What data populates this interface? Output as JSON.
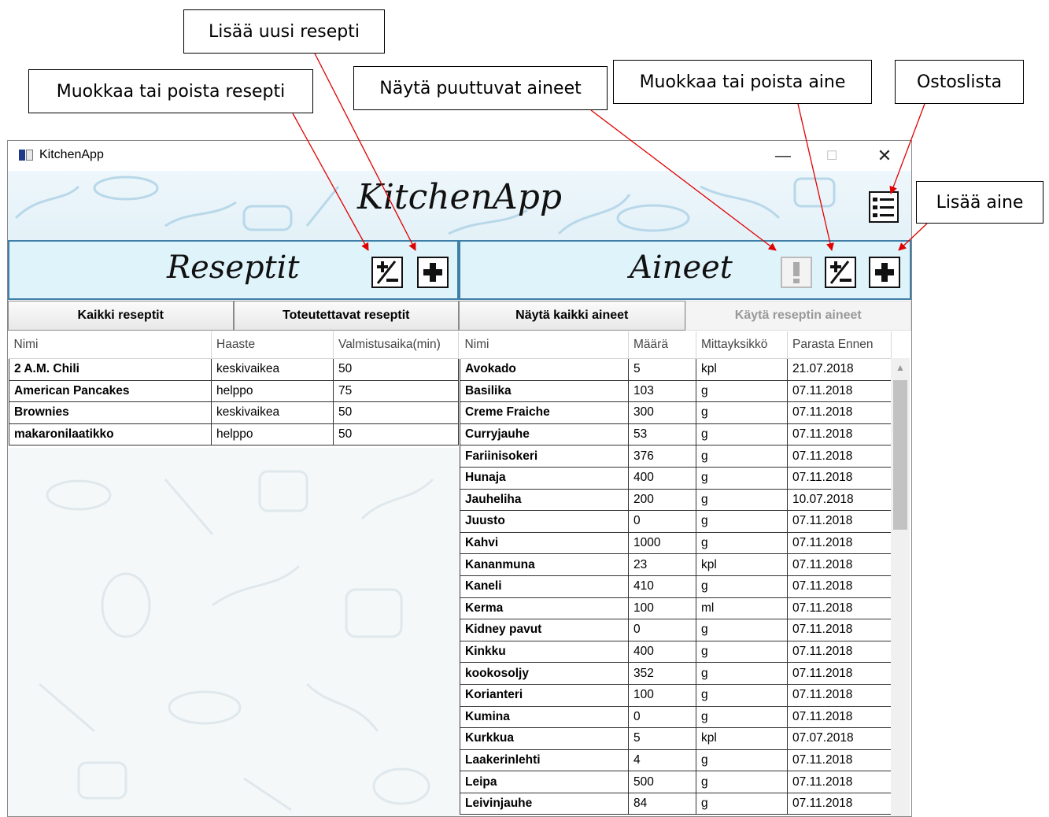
{
  "callouts": {
    "edit_recipe": "Muokkaa tai poista resepti",
    "add_recipe": "Lisää uusi resepti",
    "missing": "Näytä puuttuvat aineet",
    "edit_ingredient": "Muokkaa tai poista aine",
    "shopping_list": "Ostoslista",
    "add_ingredient": "Lisää aine"
  },
  "window": {
    "title": "KitchenApp",
    "app_title": "KitchenApp",
    "minimize": "—",
    "maximize": "☐",
    "close": "✕"
  },
  "recipes": {
    "title": "Reseptit",
    "tabs": [
      "Kaikki reseptit",
      "Toteutettavat reseptit"
    ],
    "columns": [
      "Nimi",
      "Haaste",
      "Valmistusaika(min)"
    ],
    "rows": [
      [
        "2 A.M. Chili",
        "keskivaikea",
        "50"
      ],
      [
        "American Pancakes",
        "helppo",
        "75"
      ],
      [
        "Brownies",
        "keskivaikea",
        "50"
      ],
      [
        "makaronilaatikko",
        "helppo",
        "50"
      ]
    ]
  },
  "ingredients": {
    "title": "Aineet",
    "tabs": [
      "Näytä kaikki aineet",
      "Käytä reseptin aineet"
    ],
    "columns": [
      "Nimi",
      "Määrä",
      "Mittayksikkö",
      "Parasta Ennen"
    ],
    "rows": [
      [
        "Avokado",
        "5",
        "kpl",
        "21.07.2018"
      ],
      [
        "Basilika",
        "103",
        "g",
        "07.11.2018"
      ],
      [
        "Creme Fraiche",
        "300",
        "g",
        "07.11.2018"
      ],
      [
        "Curryjauhe",
        "53",
        "g",
        "07.11.2018"
      ],
      [
        "Fariinisokeri",
        "376",
        "g",
        "07.11.2018"
      ],
      [
        "Hunaja",
        "400",
        "g",
        "07.11.2018"
      ],
      [
        "Jauheliha",
        "200",
        "g",
        "10.07.2018"
      ],
      [
        "Juusto",
        "0",
        "g",
        "07.11.2018"
      ],
      [
        "Kahvi",
        "1000",
        "g",
        "07.11.2018"
      ],
      [
        "Kananmuna",
        "23",
        "kpl",
        "07.11.2018"
      ],
      [
        "Kaneli",
        "410",
        "g",
        "07.11.2018"
      ],
      [
        "Kerma",
        "100",
        "ml",
        "07.11.2018"
      ],
      [
        "Kidney pavut",
        "0",
        "g",
        "07.11.2018"
      ],
      [
        "Kinkku",
        "400",
        "g",
        "07.11.2018"
      ],
      [
        "kookosoljy",
        "352",
        "g",
        "07.11.2018"
      ],
      [
        "Korianteri",
        "100",
        "g",
        "07.11.2018"
      ],
      [
        "Kumina",
        "0",
        "g",
        "07.11.2018"
      ],
      [
        "Kurkkua",
        "5",
        "kpl",
        "07.07.2018"
      ],
      [
        "Laakerinlehti",
        "4",
        "g",
        "07.11.2018"
      ],
      [
        "Leipa",
        "500",
        "g",
        "07.11.2018"
      ],
      [
        "Leivinjauhe",
        "84",
        "g",
        "07.11.2018"
      ]
    ]
  },
  "colors": {
    "section_bg": "#def3fa",
    "section_border": "#3f7fa8",
    "arrow": "#e00000"
  }
}
